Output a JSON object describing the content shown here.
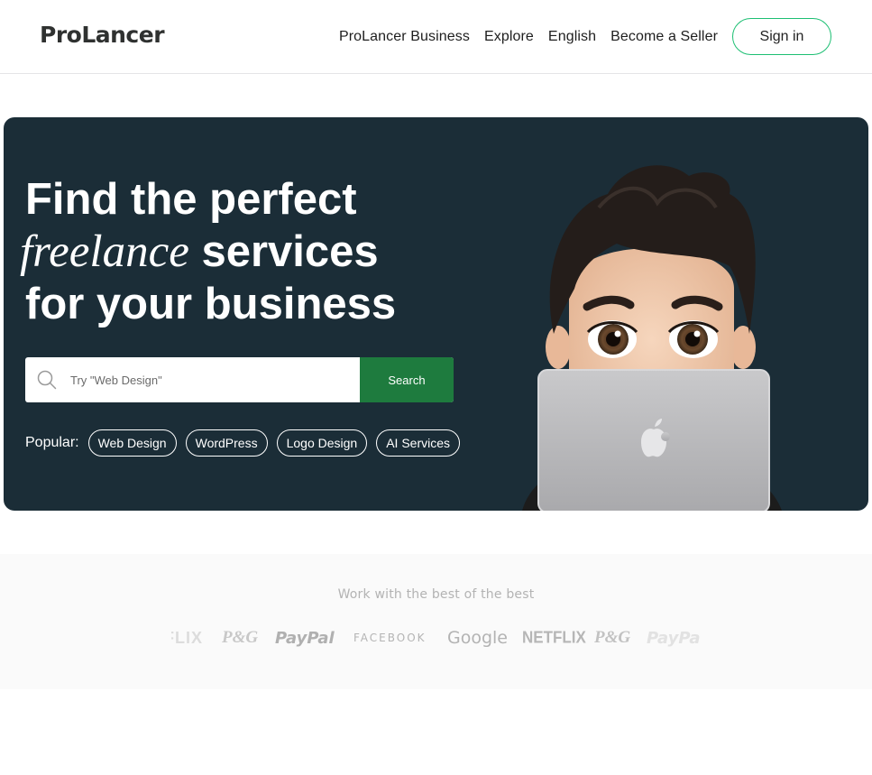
{
  "header": {
    "logo": "ProLancer",
    "nav": [
      "ProLancer Business",
      "Explore",
      "English",
      "Become a Seller"
    ],
    "signin": "Sign in"
  },
  "hero": {
    "headline_line1": "Find the perfect",
    "headline_italic": "freelance",
    "headline_line2_rest": " services",
    "headline_line3": "for your business",
    "search_placeholder": "Try \"Web Design\"",
    "search_button": "Search",
    "popular_label": "Popular:",
    "popular_tags": [
      "Web Design",
      "WordPress",
      "Logo Design",
      "AI Services"
    ]
  },
  "trusted": {
    "title": "Work with the best of the best",
    "brands": [
      "FLIX",
      "P&G",
      "PayPal",
      "FACEBOOK",
      "Google",
      "NETFLIX",
      "P&G",
      "PayPa"
    ]
  },
  "colors": {
    "hero_bg": "#1b2d37",
    "accent_green": "#1dbf73",
    "search_button": "#1e7b3e"
  },
  "icons": {
    "search": "search-icon",
    "apple": "apple-logo-icon"
  }
}
